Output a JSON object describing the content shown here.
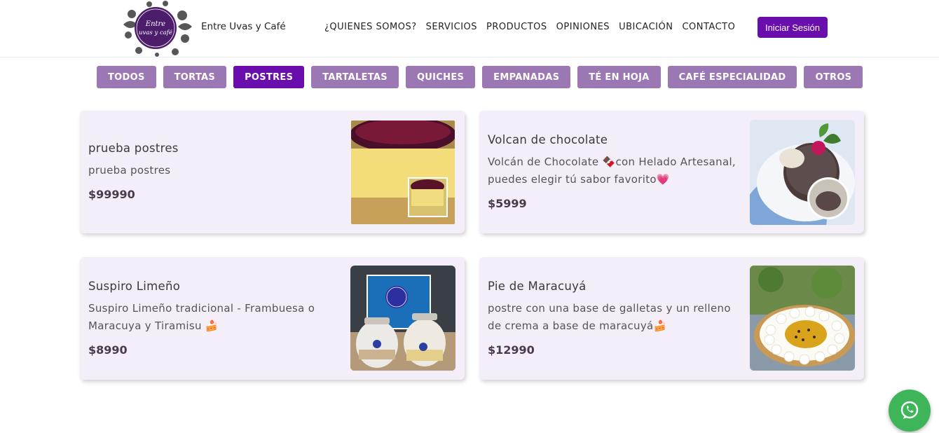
{
  "header": {
    "brand": "Entre Uvas y Café",
    "logo_text_line1": "Entre",
    "logo_text_line2": "uvas y café",
    "nav": [
      "¿QUIENES SOMOS?",
      "SERVICIOS",
      "PRODUCTOS",
      "OPINIONES",
      "UBICACIÓN",
      "CONTACTO"
    ],
    "login_label": "Iniciar Sesión"
  },
  "filters": [
    "TODOS",
    "TORTAS",
    "POSTRES",
    "TARTALETAS",
    "QUICHES",
    "EMPANADAS",
    "TÉ EN HOJA",
    "CAFÉ ESPECIALIDAD",
    "OTROS"
  ],
  "active_filter": "POSTRES",
  "products": [
    {
      "title": "prueba postres",
      "desc": "prueba postres",
      "price": "$99990"
    },
    {
      "title": "Volcan de chocolate",
      "desc": "Volcán de Chocolate 🍫con Helado Artesanal, puedes elegir tú sabor favorito💗",
      "price": "$5999"
    },
    {
      "title": "Suspiro Limeño",
      "desc": "Suspiro Limeño tradicional - Frambuesa o Maracuya y Tiramisu 🍰",
      "price": "$8990"
    },
    {
      "title": "Pie de Maracuyá",
      "desc": "postre con una base de galletas y un relleno de crema a base de maracuyá🍰",
      "price": "$12990"
    }
  ],
  "colors": {
    "accent": "#6a0dad",
    "filter": "#9b77b4",
    "card_bg": "#f3eef8",
    "whatsapp": "#3fb55a"
  },
  "icons": {
    "floating": "whatsapp-icon"
  }
}
